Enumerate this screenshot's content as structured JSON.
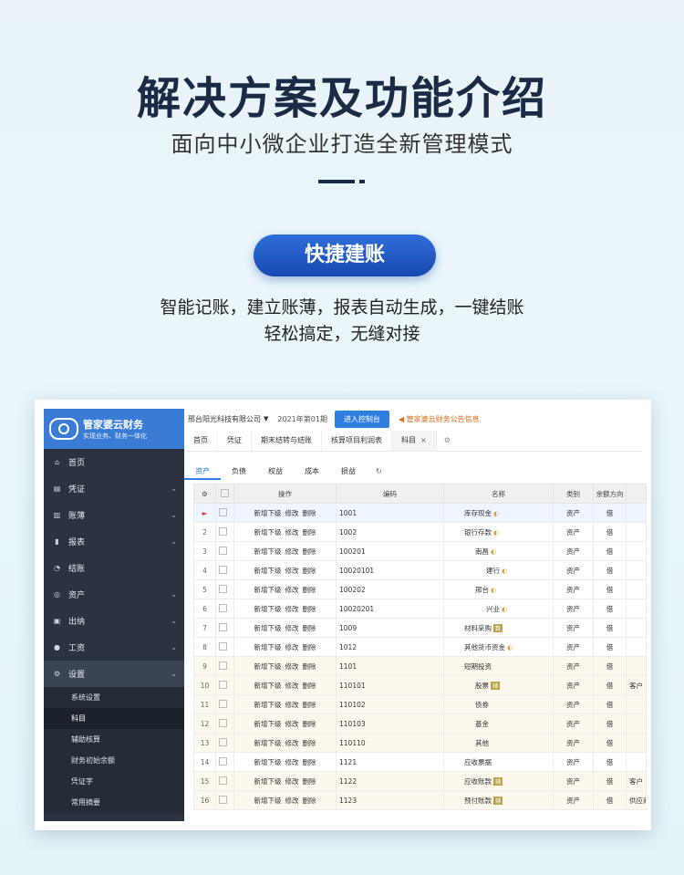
{
  "hero": {
    "title": "解决方案及功能介绍",
    "subtitle": "面向中小微企业打造全新管理模式",
    "pill": "快捷建账",
    "desc_line1": "智能记账，建立账薄，报表自动生成，一键结账",
    "desc_line2": "轻松搞定，无缝对接"
  },
  "app": {
    "brand_name": "管家婆云财务",
    "brand_slogan": "实现业务、财务一体化",
    "company": "邢台阳光科技有限公司",
    "period": "2021年第01期",
    "console_btn": "进入控制台",
    "notice": "管家婆云财务公告信息",
    "nav": [
      {
        "label": "首页",
        "icon": "home-icon",
        "glyph": "⌂",
        "chev": ""
      },
      {
        "label": "凭证",
        "icon": "voucher-icon",
        "glyph": "▤",
        "chev": "⌄"
      },
      {
        "label": "账薄",
        "icon": "ledger-icon",
        "glyph": "▥",
        "chev": "⌄"
      },
      {
        "label": "报表",
        "icon": "chart-icon",
        "glyph": "▮",
        "chev": "⌄"
      },
      {
        "label": "结账",
        "icon": "close-account-icon",
        "glyph": "◔",
        "chev": ""
      },
      {
        "label": "资产",
        "icon": "asset-icon",
        "glyph": "◎",
        "chev": "⌄"
      },
      {
        "label": "出纳",
        "icon": "cashier-icon",
        "glyph": "▣",
        "chev": "⌄"
      },
      {
        "label": "工资",
        "icon": "salary-icon",
        "glyph": "●",
        "chev": "⌄"
      },
      {
        "label": "设置",
        "icon": "settings-icon",
        "glyph": "⚙",
        "chev": "⌄"
      }
    ],
    "subnav": [
      "系统设置",
      "科目",
      "辅助核算",
      "财务初始余额",
      "凭证字",
      "常用摘要"
    ],
    "tabs": [
      "首页",
      "凭证",
      "期末结转与结账",
      "核算项目利润表",
      "科目"
    ],
    "category_tabs": [
      "资产",
      "负债",
      "权益",
      "成本",
      "损益"
    ],
    "columns": [
      "操作",
      "编码",
      "名称",
      "类别",
      "余额方向"
    ],
    "actions": {
      "add": "新增下级",
      "edit": "修改",
      "del": "删除"
    },
    "rows": [
      {
        "n": "",
        "code": "1001",
        "name": "库存现金",
        "tag": "",
        "lock": true,
        "cat": "资产",
        "dir": "借",
        "extra": "",
        "indent": 0,
        "sel": true,
        "warm": false
      },
      {
        "n": "2",
        "code": "1002",
        "name": "银行存款",
        "tag": "",
        "lock": true,
        "cat": "资产",
        "dir": "借",
        "extra": "",
        "indent": 0,
        "sel": false,
        "warm": false
      },
      {
        "n": "3",
        "code": "100201",
        "name": "南昌",
        "tag": "",
        "lock": true,
        "cat": "资产",
        "dir": "借",
        "extra": "",
        "indent": 1,
        "sel": false,
        "warm": false
      },
      {
        "n": "4",
        "code": "10020101",
        "name": "建行",
        "tag": "",
        "lock": true,
        "cat": "资产",
        "dir": "借",
        "extra": "",
        "indent": 2,
        "sel": false,
        "warm": false
      },
      {
        "n": "5",
        "code": "100202",
        "name": "邢台",
        "tag": "",
        "lock": true,
        "cat": "资产",
        "dir": "借",
        "extra": "",
        "indent": 1,
        "sel": false,
        "warm": false
      },
      {
        "n": "6",
        "code": "10020201",
        "name": "兴业",
        "tag": "",
        "lock": true,
        "cat": "资产",
        "dir": "借",
        "extra": "",
        "indent": 2,
        "sel": false,
        "warm": false
      },
      {
        "n": "7",
        "code": "1009",
        "name": "材料采购",
        "tag": "数",
        "lock": false,
        "cat": "资产",
        "dir": "借",
        "extra": "",
        "indent": 0,
        "sel": false,
        "warm": false
      },
      {
        "n": "8",
        "code": "1012",
        "name": "其他货币资金",
        "tag": "",
        "lock": true,
        "cat": "资产",
        "dir": "借",
        "extra": "",
        "indent": 0,
        "sel": false,
        "warm": false
      },
      {
        "n": "9",
        "code": "1101",
        "name": "短期投资",
        "tag": "",
        "lock": false,
        "cat": "资产",
        "dir": "借",
        "extra": "",
        "indent": 0,
        "sel": false,
        "warm": true
      },
      {
        "n": "10",
        "code": "110101",
        "name": "股票",
        "tag": "辅",
        "lock": false,
        "cat": "资产",
        "dir": "借",
        "extra": "客户",
        "indent": 1,
        "sel": false,
        "warm": true
      },
      {
        "n": "11",
        "code": "110102",
        "name": "债券",
        "tag": "",
        "lock": false,
        "cat": "资产",
        "dir": "借",
        "extra": "",
        "indent": 1,
        "sel": false,
        "warm": true
      },
      {
        "n": "12",
        "code": "110103",
        "name": "基金",
        "tag": "",
        "lock": false,
        "cat": "资产",
        "dir": "借",
        "extra": "",
        "indent": 1,
        "sel": false,
        "warm": true
      },
      {
        "n": "13",
        "code": "110110",
        "name": "其他",
        "tag": "",
        "lock": false,
        "cat": "资产",
        "dir": "借",
        "extra": "",
        "indent": 1,
        "sel": false,
        "warm": true
      },
      {
        "n": "14",
        "code": "1121",
        "name": "应收票据",
        "tag": "",
        "lock": false,
        "cat": "资产",
        "dir": "借",
        "extra": "",
        "indent": 0,
        "sel": false,
        "warm": false
      },
      {
        "n": "15",
        "code": "1122",
        "name": "应收账款",
        "tag": "辅",
        "lock": false,
        "cat": "资产",
        "dir": "借",
        "extra": "客户",
        "indent": 0,
        "sel": false,
        "warm": true
      },
      {
        "n": "16",
        "code": "1123",
        "name": "预付账款",
        "tag": "辅",
        "lock": false,
        "cat": "资产",
        "dir": "借",
        "extra": "供应商",
        "indent": 0,
        "sel": false,
        "warm": true
      }
    ]
  }
}
